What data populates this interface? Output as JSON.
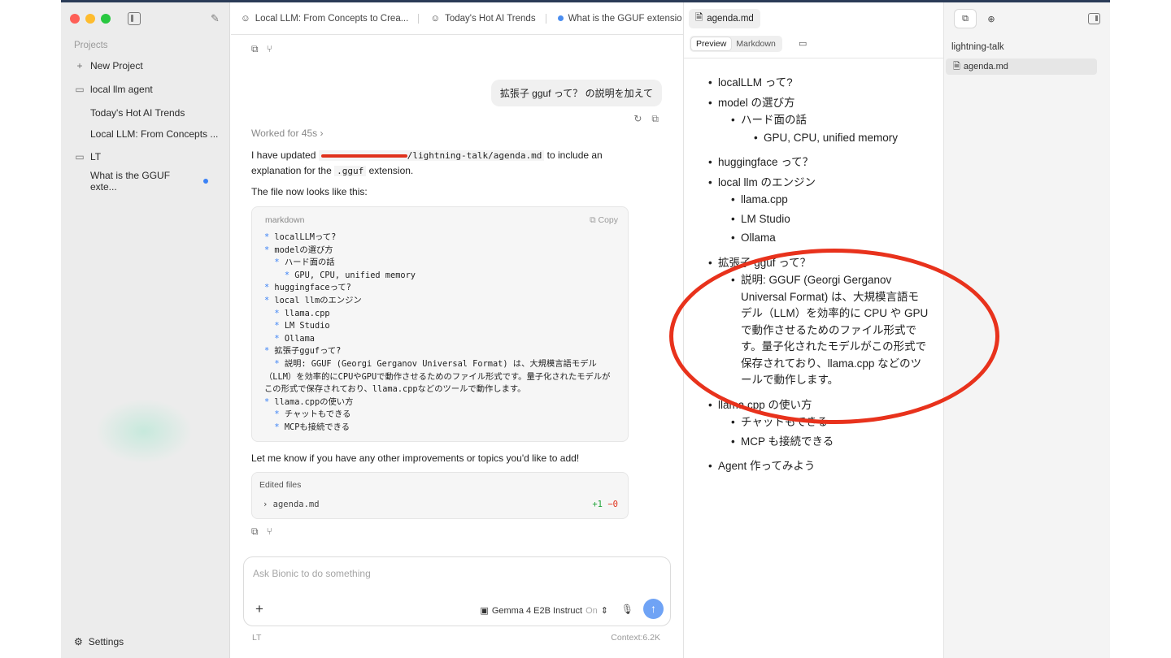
{
  "sidebar": {
    "section_label": "Projects",
    "new_project": "New Project",
    "projects": [
      {
        "name": "local llm agent",
        "chats": [
          "Today's Hot AI Trends",
          "Local LLM: From Concepts ..."
        ]
      },
      {
        "name": "LT",
        "chats": [
          "What is the GGUF exte..."
        ]
      }
    ],
    "settings": "Settings"
  },
  "tabs": [
    {
      "label": "Local LLM: From Concepts to Crea..."
    },
    {
      "label": "Today's Hot AI Trends"
    },
    {
      "label": "What is the GGUF extensio"
    }
  ],
  "chat": {
    "user_message": "拡張子 gguf って？ の説明を加えて",
    "worked_for": "Worked for 45s",
    "reply_prefix": "I have updated",
    "reply_path": "/lightning-talk/agenda.md",
    "reply_mid": "to include an explanation for the",
    "reply_ext": ".gguf",
    "reply_end": "extension.",
    "file_looks": "The file now looks like this:",
    "code_lang": "markdown",
    "copy_label": "Copy",
    "code_lines": [
      {
        "i": "",
        "t": "localLLMって?"
      },
      {
        "i": "",
        "t": "modelの選び方"
      },
      {
        "i": "  ",
        "t": "ハード面の話"
      },
      {
        "i": "    ",
        "t": "GPU, CPU, unified memory"
      },
      {
        "i": "",
        "t": "huggingfaceって?"
      },
      {
        "i": "",
        "t": "local llmのエンジン"
      },
      {
        "i": "  ",
        "t": "llama.cpp"
      },
      {
        "i": "  ",
        "t": "LM Studio"
      },
      {
        "i": "  ",
        "t": "Ollama"
      },
      {
        "i": "",
        "t": "拡張子ggufって?"
      },
      {
        "i": "  ",
        "t": "説明: GGUF (Georgi Gerganov Universal Format) は、大規模言語モデル（LLM）を効率的にCPUやGPUで動作させるためのファイル形式です。量子化されたモデルがこの形式で保存されており、llama.cppなどのツールで動作します。"
      },
      {
        "i": "",
        "t": "llama.cppの使い方"
      },
      {
        "i": "  ",
        "t": "チャットもできる"
      },
      {
        "i": "  ",
        "t": "MCPも接続できる"
      }
    ],
    "followup": "Let me know if you have any other improvements or topics you'd like to add!",
    "edited_title": "Edited files",
    "edited_file": "agenda.md",
    "diff_plus": "+1",
    "diff_minus": "−0",
    "composer_placeholder": "Ask Bionic to do something",
    "model": "Gemma 4 E2B Instruct",
    "model_state": "On",
    "footer_left": "LT",
    "footer_right": "Context:6.2K"
  },
  "preview": {
    "tab_label": "agenda.md",
    "mode_preview": "Preview",
    "mode_markdown": "Markdown",
    "items": {
      "l1": "localLLM って?",
      "l2": "model の選び方",
      "l2a": "ハード面の話",
      "l2a1": "GPU, CPU, unified memory",
      "l3": "huggingface って？",
      "l4": "local llm のエンジン",
      "l4a": "llama.cpp",
      "l4b": "LM Studio",
      "l4c": "Ollama",
      "l5": "拡張子 gguf って？",
      "l5a": "説明: GGUF (Georgi Gerganov Universal Format) は、大規模言語モデル（LLM）を効率的に CPU や GPU で動作させるためのファイル形式です。量子化されたモデルがこの形式で保存されており、llama.cpp などのツールで動作します。",
      "l6": "llama.cpp の使い方",
      "l6a": "チャットもできる",
      "l6b": "MCP も接続できる",
      "l7": "Agent 作ってみよう"
    }
  },
  "files": {
    "project": "lightning-talk",
    "file": "agenda.md"
  },
  "colors": {
    "accent": "#3b82f6",
    "annotation": "#e8321c",
    "send": "#6fa3f5"
  }
}
